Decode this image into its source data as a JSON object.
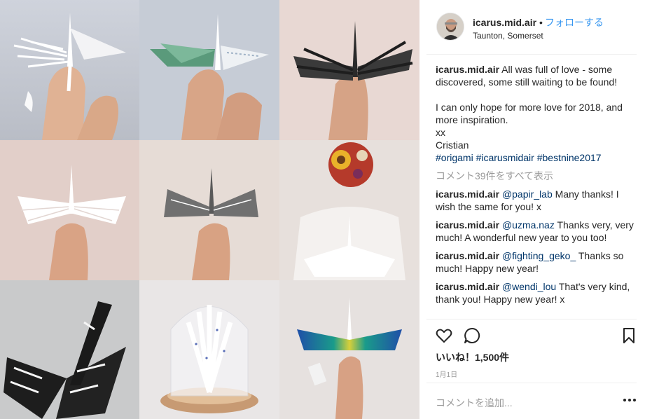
{
  "post": {
    "username": "icarus.mid.air",
    "separator": "•",
    "follow_label": "フォローする",
    "location": "Taunton, Somerset",
    "caption": {
      "line1": "All was full of love - some discovered, some still waiting to be found!",
      "line2": "I can only hope for more love for 2018, and more inspiration.",
      "line3": "xx",
      "line4": "Cristian",
      "hashtags": "#origami #icarusmidair #bestnine2017"
    },
    "view_all_comments": "コメント39件をすべて表示",
    "comments": [
      {
        "user": "icarus.mid.air",
        "mention": "@papir_lab",
        "text": " Many thanks! I wish the same for you! x"
      },
      {
        "user": "icarus.mid.air",
        "mention": "@uzma.naz",
        "text": " Thanks very, very much! A wonderful new year to you too!"
      },
      {
        "user": "icarus.mid.air",
        "mention": "@fighting_geko_",
        "text": " Thanks so much! Happy new year!"
      },
      {
        "user": "icarus.mid.air",
        "mention": "@wendi_lou",
        "text": " That's very kind, thank you! Happy new year! x"
      }
    ],
    "likes": "いいね！1,500件",
    "date": "1月1日",
    "add_comment_placeholder": "コメントを追加..."
  },
  "icons": {
    "heart": "heart-icon",
    "comment": "comment-icon",
    "bookmark": "bookmark-icon",
    "more": "more-options-icon"
  },
  "colors": {
    "link": "#003569",
    "follow": "#3897f0",
    "muted": "#999999",
    "text": "#262626"
  }
}
